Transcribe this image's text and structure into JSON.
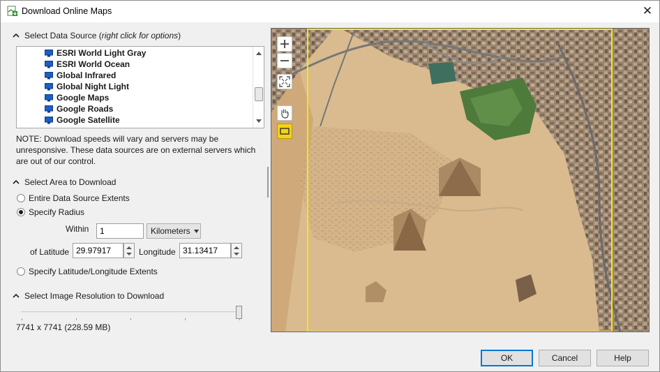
{
  "window": {
    "title": "Download Online Maps",
    "close_glyph": "✕"
  },
  "data_source": {
    "heading": "Select Data Source",
    "hint": "right click for options",
    "items": [
      {
        "label": "ESRI World Light Gray",
        "icon": "monitor-icon"
      },
      {
        "label": "ESRI World Ocean",
        "icon": "monitor-icon"
      },
      {
        "label": "Global Infrared",
        "icon": "monitor-icon"
      },
      {
        "label": "Global Night Light",
        "icon": "monitor-icon"
      },
      {
        "label": "Google Maps",
        "icon": "monitor-icon"
      },
      {
        "label": "Google Roads",
        "icon": "monitor-icon"
      },
      {
        "label": "Google Satellite",
        "icon": "monitor-icon"
      }
    ],
    "selected": "Google Satellite",
    "note": "NOTE: Download speeds will vary and servers may be unresponsive.  These data sources are on external servers which are out of our control."
  },
  "area": {
    "heading": "Select Area to Download",
    "option_extents": "Entire Data Source Extents",
    "option_radius": "Specify Radius",
    "option_latlon": "Specify Latitude/Longitude Extents",
    "selected_option": "Specify Radius",
    "within_label": "Within",
    "within_value": "1",
    "units": "Kilometers",
    "lat_label": "of Latitude",
    "lat_value": "29.97917",
    "lon_label": "Longitude",
    "lon_value": "31.13417"
  },
  "resolution": {
    "heading": "Select Image Resolution to Download",
    "slider_level": 1.0,
    "value_text": "7741 x 7741  (228.59 MB)"
  },
  "map": {
    "tools": [
      "zoom-in-icon",
      "zoom-out-icon",
      "zoom-extents-icon",
      "pan-hand-icon",
      "select-rectangle-icon"
    ],
    "selection_color": "#f5e614",
    "active_tool": "select-rectangle-icon"
  },
  "buttons": {
    "ok": "OK",
    "cancel": "Cancel",
    "help": "Help"
  },
  "colors": {
    "accent": "#0078d7",
    "tool_active": "#f2d21b"
  }
}
